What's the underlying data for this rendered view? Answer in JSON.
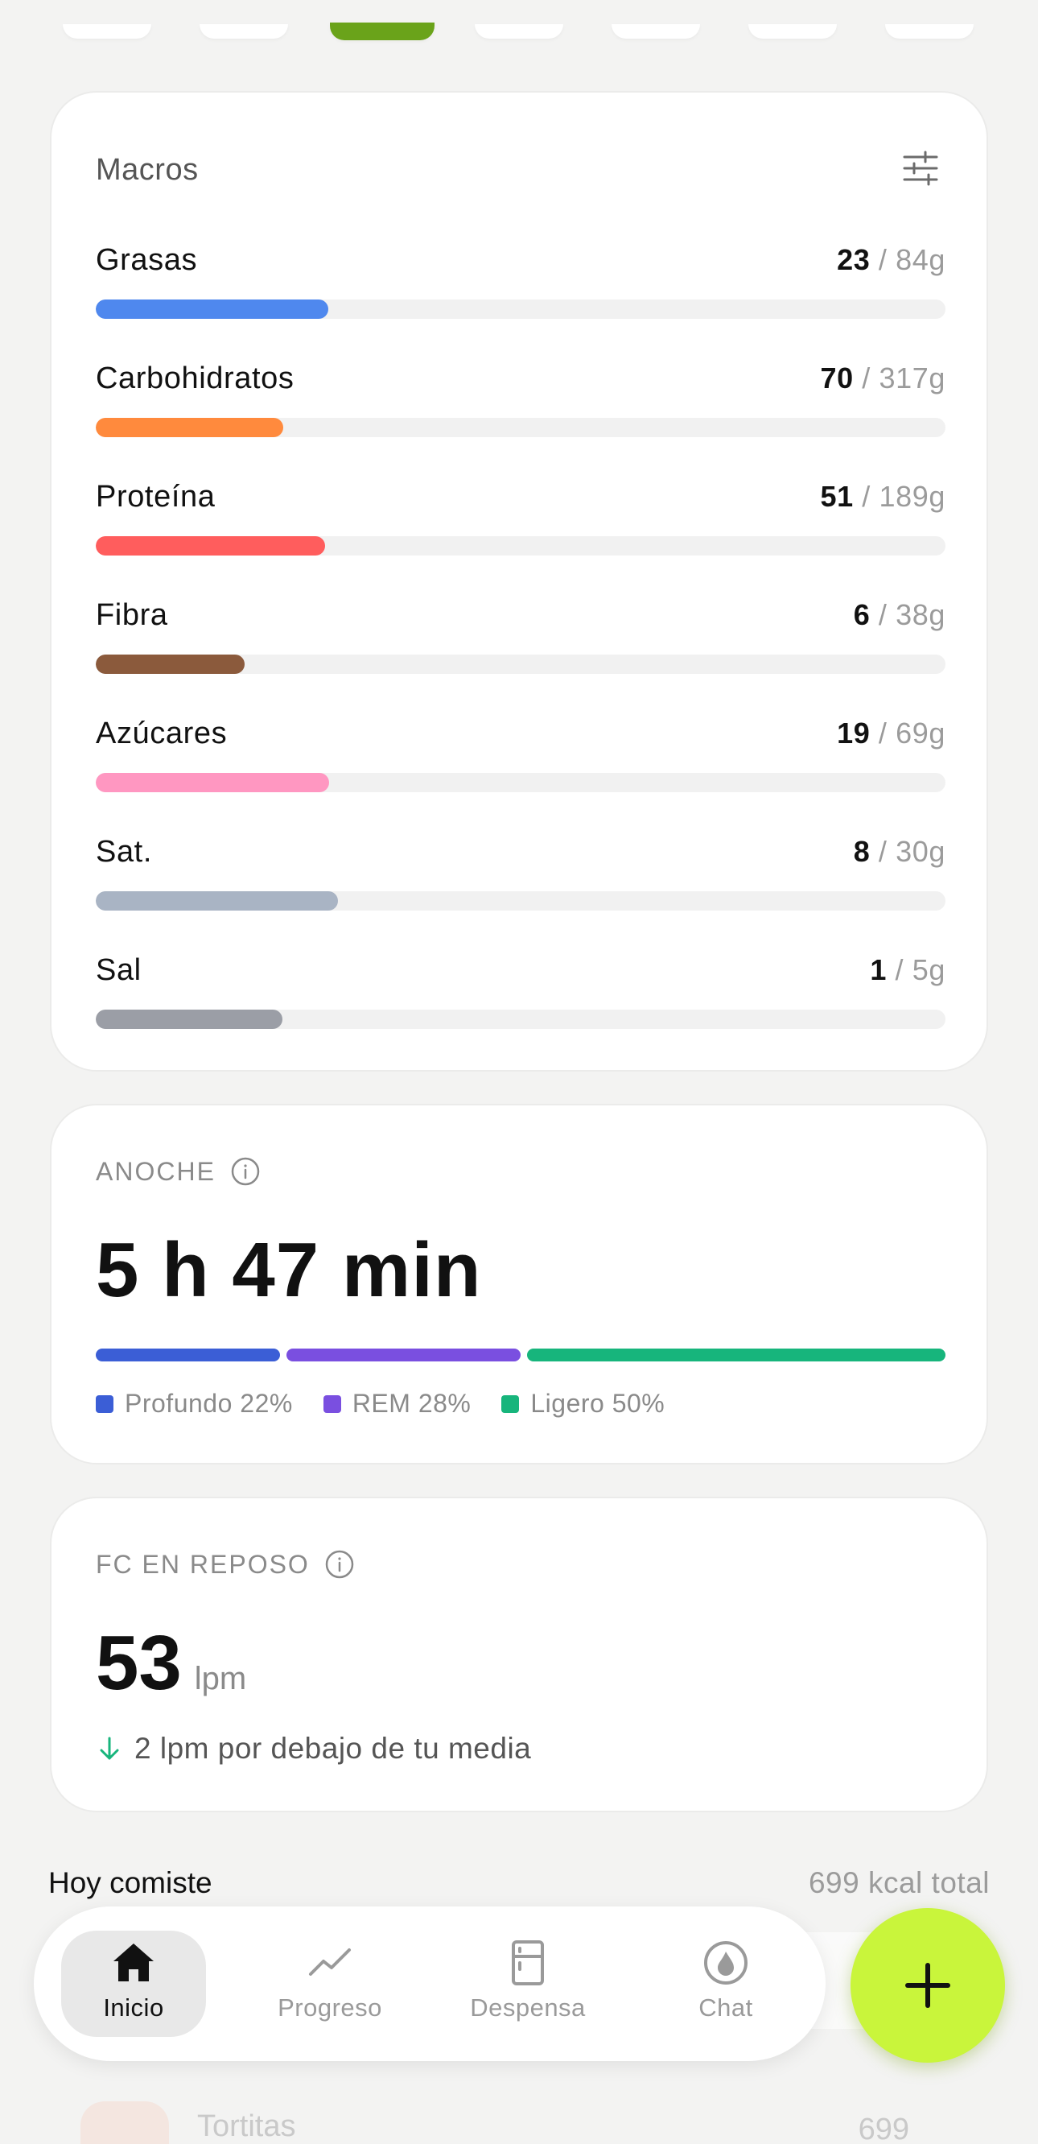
{
  "macros": {
    "title": "Macros",
    "items": [
      {
        "name": "Grasas",
        "current": "23",
        "target": " / 84g",
        "fraction": 0.274,
        "color": "#4f88ee"
      },
      {
        "name": "Carbohidratos",
        "current": "70",
        "target": " / 317g",
        "fraction": 0.221,
        "color": "#ff8a3d"
      },
      {
        "name": "Proteína",
        "current": "51",
        "target": " / 189g",
        "fraction": 0.27,
        "color": "#ff5d5d"
      },
      {
        "name": "Fibra",
        "current": "6",
        "target": " / 38g",
        "fraction": 0.175,
        "color": "#8b5a3c"
      },
      {
        "name": "Azúcares",
        "current": "19",
        "target": " / 69g",
        "fraction": 0.275,
        "color": "#ff97c1"
      },
      {
        "name": "Sat.",
        "current": "8",
        "target": " / 30g",
        "fraction": 0.285,
        "color": "#a9b4c4"
      },
      {
        "name": "Sal",
        "current": "1",
        "target": " / 5g",
        "fraction": 0.22,
        "color": "#9b9ea6"
      }
    ]
  },
  "sleep": {
    "label": "ANOCHE",
    "total": "5 h 47 min",
    "stages": [
      {
        "name": "Profundo 22%",
        "percent": 22,
        "color": "#3b5ed6"
      },
      {
        "name": "REM 28%",
        "percent": 28,
        "color": "#7a4fe0"
      },
      {
        "name": "Ligero 50%",
        "percent": 50,
        "color": "#17b57c"
      }
    ]
  },
  "resting_hr": {
    "label": "FC EN REPOSO",
    "value": "53",
    "unit": "lpm",
    "trend_text": "2 lpm por debajo de tu media",
    "trend_color": "#17b57c"
  },
  "today": {
    "title": "Hoy comiste",
    "total": "699 kcal total",
    "meal": {
      "name": "Tortitas",
      "kcal": "699"
    }
  },
  "nav": {
    "items": [
      {
        "label": "Inicio",
        "icon": "home-icon"
      },
      {
        "label": "Progreso",
        "icon": "trend-chart-icon"
      },
      {
        "label": "Despensa",
        "icon": "fridge-icon"
      },
      {
        "label": "Chat",
        "icon": "chat-flame-icon"
      }
    ],
    "fab_icon": "plus-icon",
    "fab_color": "#c9f53b"
  }
}
